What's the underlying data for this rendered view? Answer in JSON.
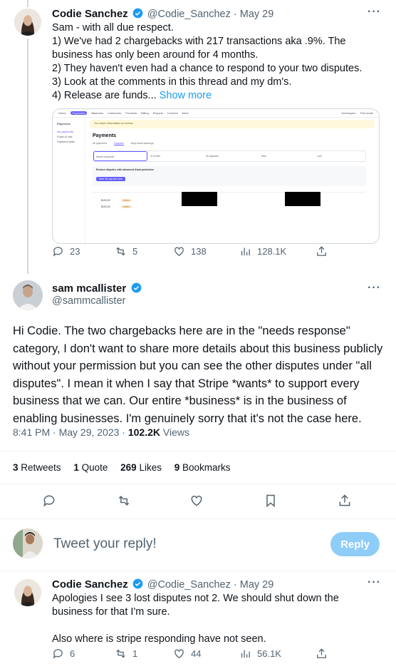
{
  "tweet1": {
    "name": "Codie Sanchez",
    "handle": "@Codie_Sanchez",
    "date": "· May 29",
    "lines": [
      "Sam - with all due respect.",
      "1) We've had 2 chargebacks with 217 transactions aka .9%. The business has only been around for 4 months.",
      "2) They haven't even had a chance to respond to your two disputes.",
      "3) Look at the comments in this thread and my dm's.",
      "4) Release are funds..."
    ],
    "show_more": "Show more",
    "replies": "23",
    "retweets": "5",
    "likes": "138",
    "views": "128.1K"
  },
  "embed": {
    "nav": [
      "Home",
      "Payments",
      "Balances",
      "Customers",
      "Products",
      "Billing",
      "Reports",
      "Connect",
      "More"
    ],
    "nav_right": [
      "Developers",
      "Test mode"
    ],
    "banner": "You have information to review",
    "sidebar_title": "Payments",
    "sidebar_items": [
      "All payments",
      "Fraud & risk",
      "Payment links"
    ],
    "page_title": "Payments",
    "tabs": [
      "All payments",
      "Disputes",
      "Early fraud warnings"
    ],
    "filter_chip": "Needs response",
    "cols": [
      "In review",
      "All disputes",
      "Won",
      "Lost"
    ],
    "notice_title": "Reduce disputes with advanced fraud protection",
    "notice_btn": "Start 30-day free trial",
    "row_amounts": [
      "$100.00",
      "$100.00"
    ]
  },
  "tweet2": {
    "name": "sam mcallister",
    "handle": "@sammcallister",
    "text": "Hi Codie. The two chargebacks here are in the \"needs response\" category, I don't want to share more details about this business publicly without your permission but you can see the other disputes under \"all disputes\". I mean it when I say that Stripe *wants* to support every business that we can. Our entire *business* is in the business of enabling businesses. I'm genuinely sorry that it's not the case here.",
    "time": "8:41 PM · May 29, 2023 ·",
    "views_count": "102.2K",
    "views_label": "Views",
    "retweets_count": "3",
    "retweets_label": "Retweets",
    "quotes_count": "1",
    "quotes_label": "Quote",
    "likes_count": "269",
    "likes_label": "Likes",
    "bookmarks_count": "9",
    "bookmarks_label": "Bookmarks"
  },
  "compose": {
    "placeholder": "Tweet your reply!",
    "button": "Reply"
  },
  "tweet3": {
    "name": "Codie Sanchez",
    "handle": "@Codie_Sanchez",
    "date": "· May 29",
    "line1": "Apologies I see 3 lost disputes not 2. We should shut down the business for that I'm sure.",
    "line2": "Also where is stripe responding have not seen.",
    "replies": "6",
    "retweets": "1",
    "likes": "44",
    "views": "56.1K"
  },
  "colors": {
    "accent": "#1d9bf0",
    "verified": "#1d9bf0",
    "stripe": "#635bff"
  }
}
